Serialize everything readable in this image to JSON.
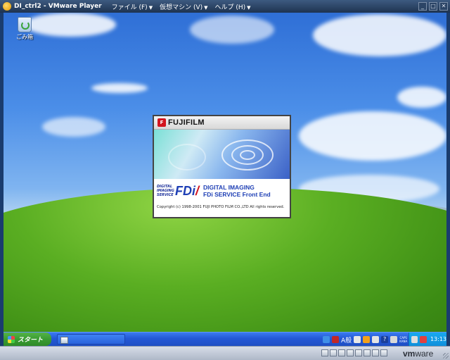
{
  "vmware": {
    "title": "DI_ctrl2 - VMware Player",
    "menus": [
      {
        "label": "ファイル (F)"
      },
      {
        "label": "仮想マシン (V)"
      },
      {
        "label": "ヘルプ (H)"
      }
    ],
    "brand_vm": "vm",
    "brand_ware": "ware"
  },
  "desktop": {
    "icons": [
      {
        "label": "ごみ箱"
      }
    ]
  },
  "splash": {
    "brand": "FUJIFILM",
    "logo_small_lines": [
      "DIGITAL",
      "IMAGING",
      "SERVICE"
    ],
    "logo_text": "FDi",
    "product_line1": "DIGITAL IMAGING",
    "product_line2": "FDi SERVICE Front End",
    "copyright": "Copyright (c) 1998-2001 FUJI PHOTO FILM CO.,LTD All rights reserved."
  },
  "taskbar": {
    "start_label": "スタート",
    "ime_label": "A般",
    "caps_line1": "CAPS",
    "caps_line2": "KANA",
    "clock": "13:13"
  },
  "colors": {
    "fuji_red": "#d2141e",
    "product_blue": "#1e3fb5",
    "start_green": "#3a9c32",
    "taskbar_blue": "#2458d6"
  }
}
